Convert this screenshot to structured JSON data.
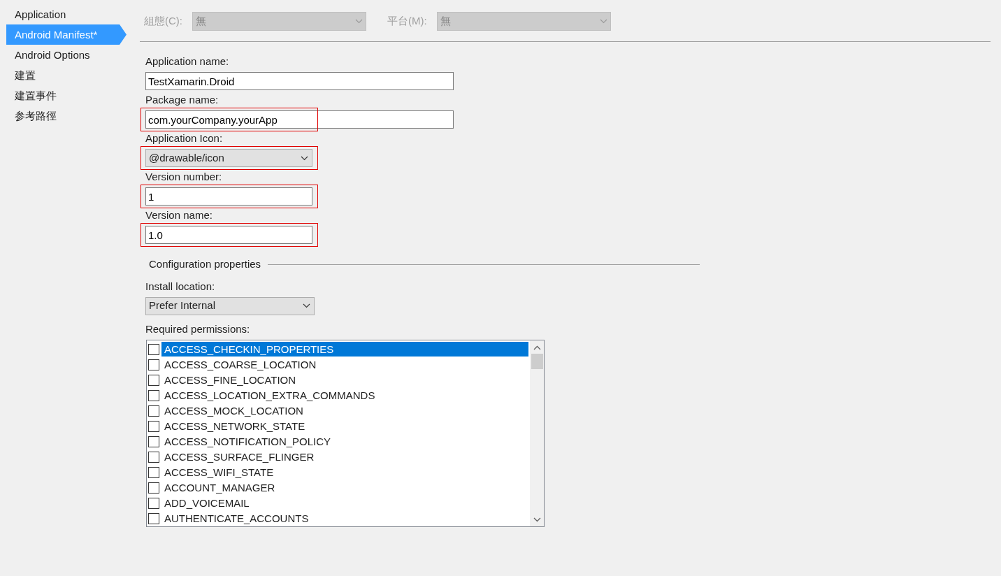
{
  "sidebar": {
    "items": [
      {
        "label": "Application",
        "selected": false
      },
      {
        "label": "Android Manifest*",
        "selected": true
      },
      {
        "label": "Android Options",
        "selected": false
      },
      {
        "label": "建置",
        "selected": false
      },
      {
        "label": "建置事件",
        "selected": false
      },
      {
        "label": "参考路徑",
        "selected": false
      }
    ]
  },
  "toolbar": [
    {
      "label": "組態(C):",
      "value": "無",
      "disabled": true
    },
    {
      "label": "平台(M):",
      "value": "無",
      "disabled": true
    }
  ],
  "fields": [
    {
      "kind": "text",
      "label": "Application name:",
      "value": "TestXamarin.Droid",
      "highlighted": false
    },
    {
      "kind": "text",
      "label": "Package name:",
      "value": "com.yourCompany.yourApp",
      "highlighted": true
    },
    {
      "kind": "select",
      "label": "Application Icon:",
      "value": "@drawable/icon",
      "highlighted": true
    },
    {
      "kind": "shorttext",
      "label": "Version number:",
      "value": "1",
      "highlighted": true
    },
    {
      "kind": "shorttext",
      "label": "Version name:",
      "value": "1.0",
      "highlighted": true
    }
  ],
  "configuration": {
    "title": "Configuration properties",
    "install_location": {
      "label": "Install location:",
      "value": "Prefer Internal"
    },
    "permissions": {
      "label": "Required permissions:",
      "items": [
        {
          "name": "ACCESS_CHECKIN_PROPERTIES",
          "checked": false,
          "selected": true
        },
        {
          "name": "ACCESS_COARSE_LOCATION",
          "checked": false,
          "selected": false
        },
        {
          "name": "ACCESS_FINE_LOCATION",
          "checked": false,
          "selected": false
        },
        {
          "name": "ACCESS_LOCATION_EXTRA_COMMANDS",
          "checked": false,
          "selected": false
        },
        {
          "name": "ACCESS_MOCK_LOCATION",
          "checked": false,
          "selected": false
        },
        {
          "name": "ACCESS_NETWORK_STATE",
          "checked": false,
          "selected": false
        },
        {
          "name": "ACCESS_NOTIFICATION_POLICY",
          "checked": false,
          "selected": false
        },
        {
          "name": "ACCESS_SURFACE_FLINGER",
          "checked": false,
          "selected": false
        },
        {
          "name": "ACCESS_WIFI_STATE",
          "checked": false,
          "selected": false
        },
        {
          "name": "ACCOUNT_MANAGER",
          "checked": false,
          "selected": false
        },
        {
          "name": "ADD_VOICEMAIL",
          "checked": false,
          "selected": false
        },
        {
          "name": "AUTHENTICATE_ACCOUNTS",
          "checked": false,
          "selected": false
        }
      ]
    }
  }
}
